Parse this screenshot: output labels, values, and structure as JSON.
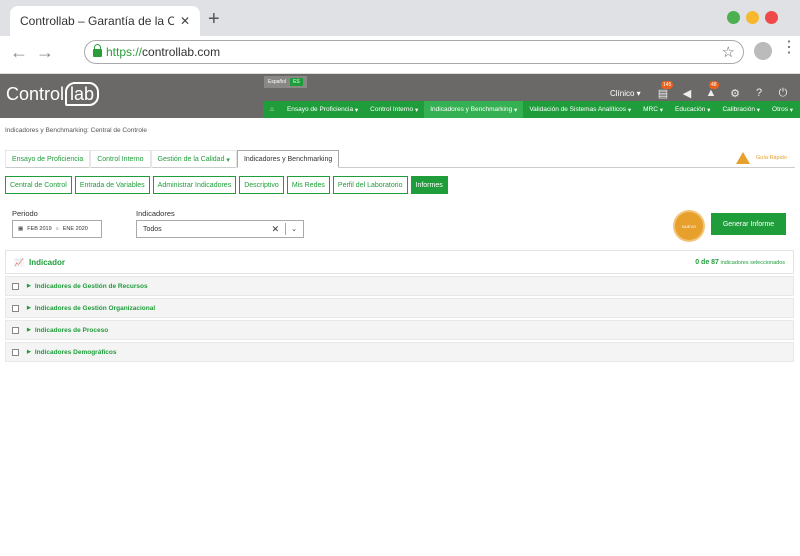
{
  "browser": {
    "tab_title": "Controllab – Garantía de la Cali",
    "url_scheme": "https://",
    "url_host": "controllab.com",
    "dot_colors": [
      "#4caf50",
      "#f5b82e",
      "#ef4a4a"
    ]
  },
  "header": {
    "logo_text": "Control",
    "logo_lab": "lab",
    "lang_label": "Español",
    "lang_code": "ES",
    "profile_label": "Clínico",
    "badge_1": "145",
    "badge_2": "48"
  },
  "nav": {
    "items": [
      "Ensayo de Proficiencia",
      "Control Interno",
      "Indicadores y Benchmarking",
      "Validación de Sistemas Analíticos",
      "MRC",
      "Educación",
      "Calibración",
      "Otros"
    ],
    "active_index": 2
  },
  "breadcrumb": "Indicadores y Benchmarking: Central de Controle",
  "tabs": [
    "Ensayo de Proficiencia",
    "Control Interno",
    "Gestión de la Calidad",
    "Indicadores y Benchmarking"
  ],
  "guia_label": "Guía Rápido",
  "subtabs": [
    "Central de Control",
    "Entrada de Variables",
    "Administrar Indicadores",
    "Descriptivo",
    "Mis Redes",
    "Perfil del Laboratorio",
    "Informes"
  ],
  "filters": {
    "period_label": "Periodo",
    "period_from": "FEB 2019",
    "period_sep": "a",
    "period_to": "ENE 2020",
    "indicators_label": "Indicadores",
    "indicators_value": "Todos"
  },
  "seal_text": "NUEVO",
  "generate_button": "Generar Informe",
  "indicator_panel": {
    "title": "Indicador",
    "count_selected": "0 de 87",
    "count_text": "indicadores seleccionados"
  },
  "groups": [
    "Indicadores de Gestión de Recursos",
    "Indicadores de Gestión Organizacional",
    "Indicadores de Proceso",
    "Indicadores Demográficos"
  ]
}
